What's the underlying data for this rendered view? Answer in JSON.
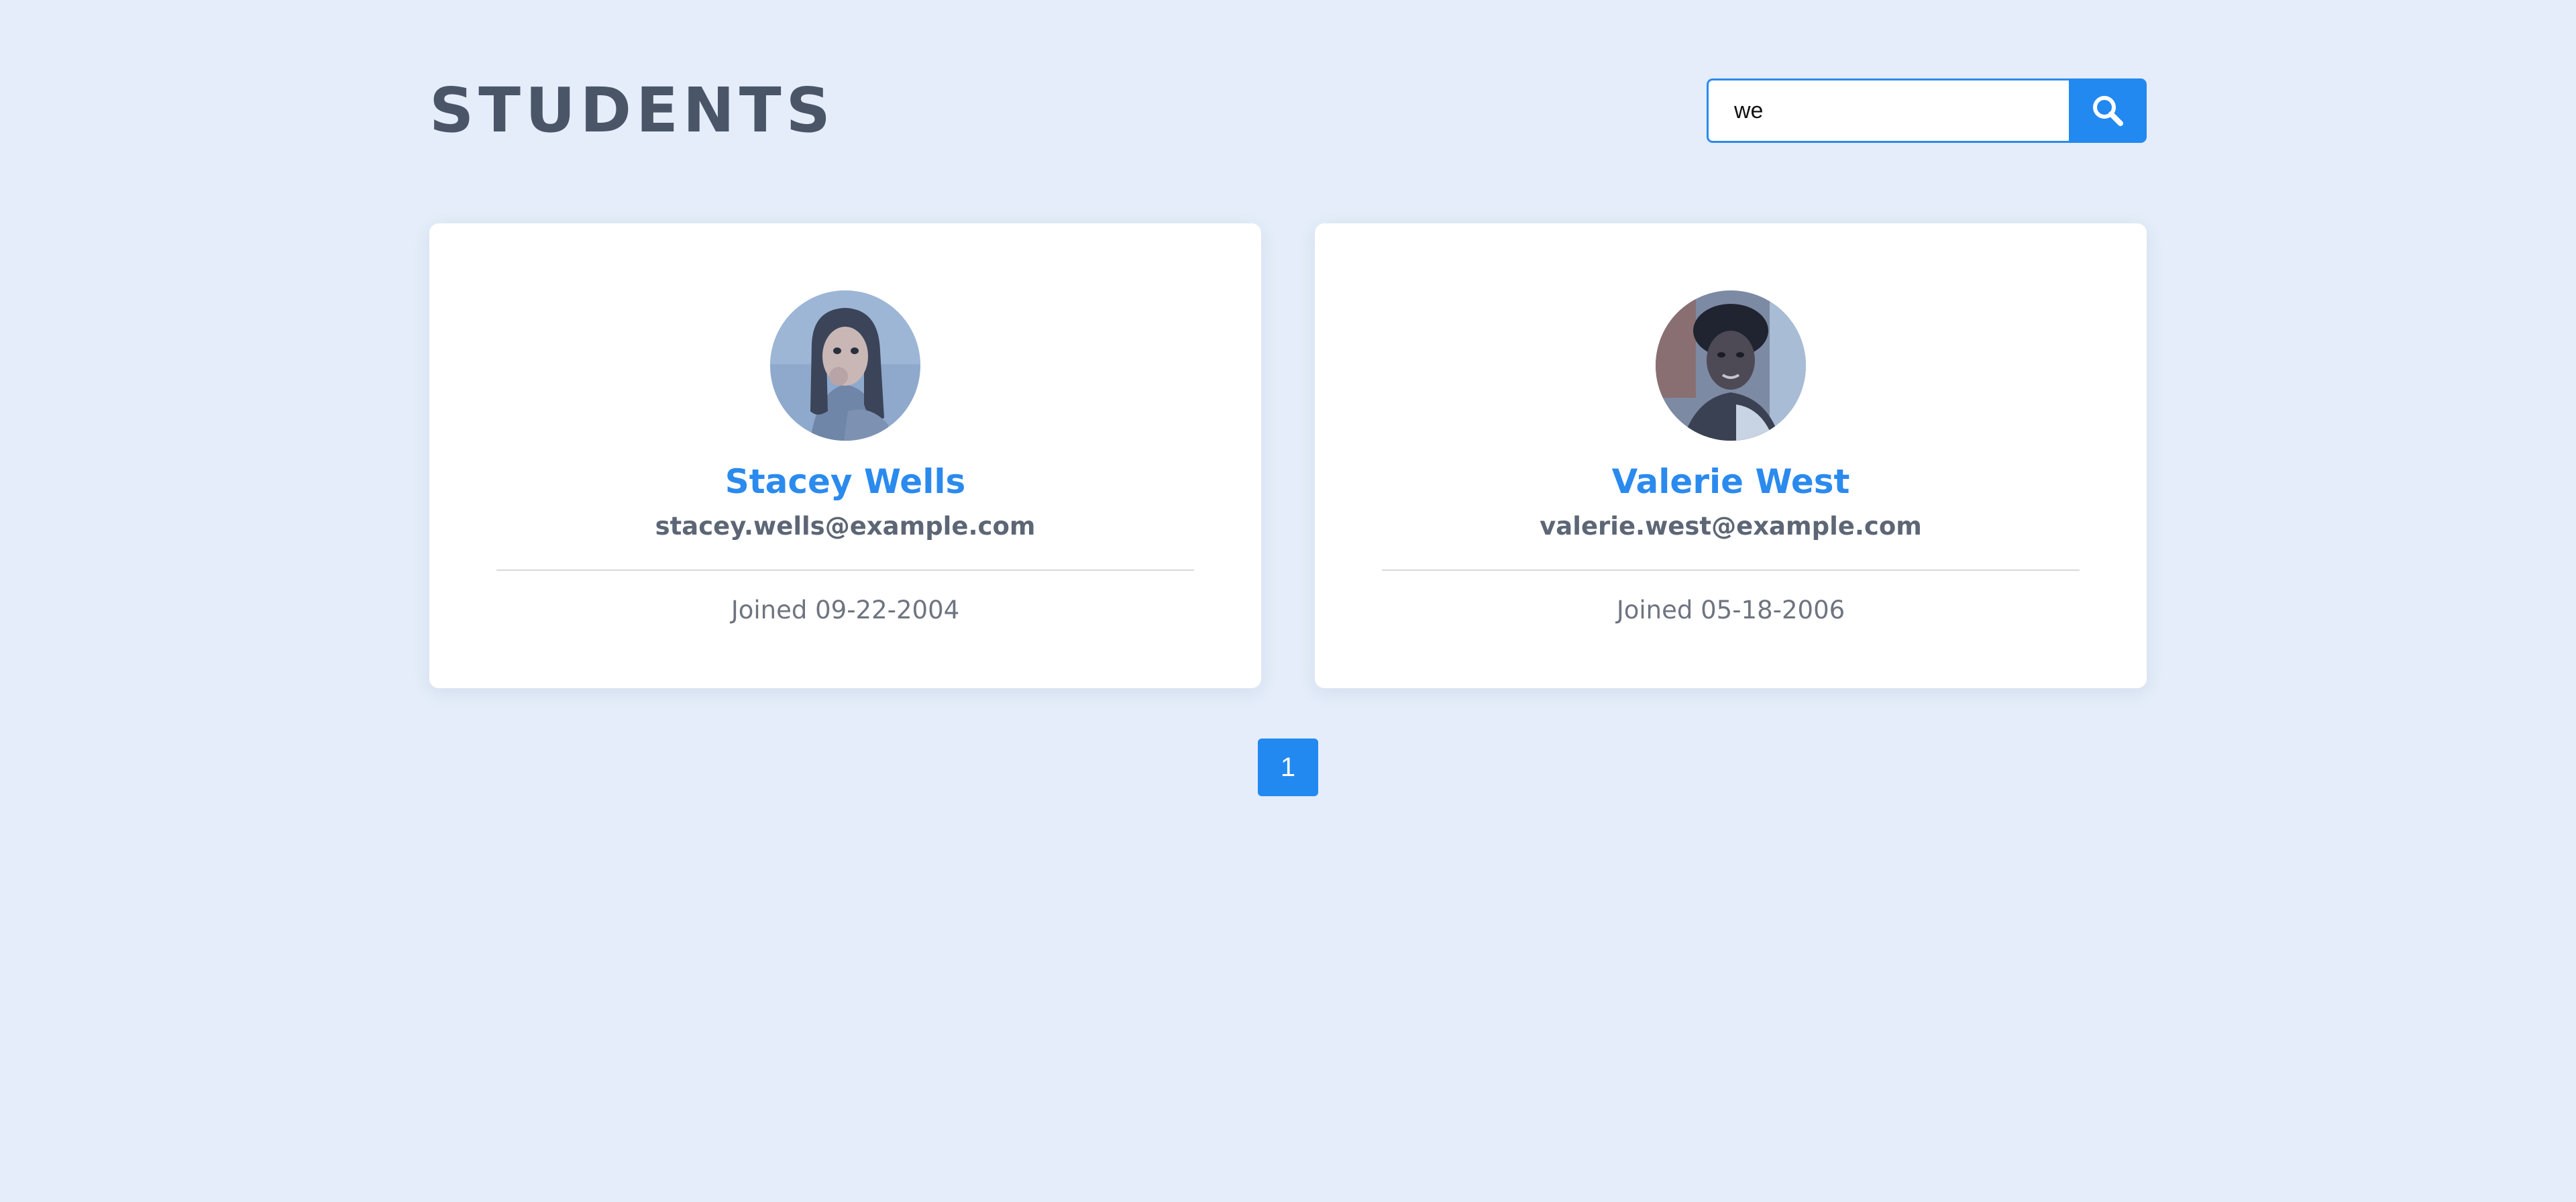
{
  "header": {
    "title": "STUDENTS"
  },
  "search": {
    "value": "we",
    "button_icon": "search-icon"
  },
  "students": [
    {
      "name": "Stacey Wells",
      "email": "stacey.wells@example.com",
      "joined": "Joined 09-22-2004"
    },
    {
      "name": "Valerie West",
      "email": "valerie.west@example.com",
      "joined": "Joined 05-18-2006"
    }
  ],
  "pagination": {
    "pages": [
      "1"
    ],
    "current": "1"
  },
  "colors": {
    "background": "#e4edf9",
    "accent": "#2289f0",
    "title": "#4a5568",
    "card": "#ffffff"
  }
}
